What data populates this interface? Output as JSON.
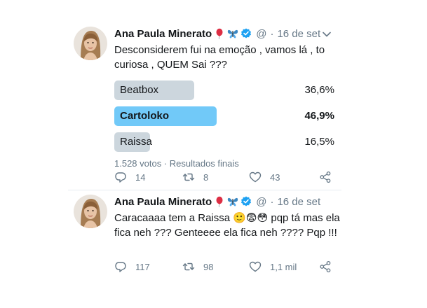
{
  "tweets": [
    {
      "author": "Ana Paula Minerato",
      "handle": "@",
      "separator": "·",
      "date": "16 de set",
      "text": "Desconsiderem fui na emoção , vamos lá , to curiosa , QUEM Sai ???",
      "header_icons": [
        "balloon-icon",
        "butterfly-icon",
        "verified-badge-icon"
      ],
      "poll": {
        "options": [
          {
            "label": "Beatbox",
            "percent_text": "36,6%",
            "value": 36.6,
            "winner": false
          },
          {
            "label": "Cartoloko",
            "percent_text": "46,9%",
            "value": 46.9,
            "winner": true
          },
          {
            "label": "Raissa",
            "percent_text": "16,5%",
            "value": 16.5,
            "winner": false
          }
        ],
        "meta": "1.528 votos · Resultados finais"
      },
      "actions": {
        "replies": "14",
        "retweets": "8",
        "likes": "43"
      }
    },
    {
      "author": "Ana Paula Minerato",
      "handle": "@",
      "separator": "·",
      "date": "16 de set",
      "text": "Caracaaaa tem a Raissa 🙂😨😳 pqp tá mas ela fica neh ??? Genteeee ela fica neh ???? Pqp !!!",
      "header_icons": [
        "balloon-icon",
        "butterfly-icon",
        "verified-badge-icon"
      ],
      "actions": {
        "replies": "117",
        "retweets": "98",
        "likes": "1,1 mil"
      }
    }
  ],
  "colors": {
    "poll_winner": "#71c9f8",
    "poll_default": "#ccd6dd",
    "secondary_text": "#657786",
    "verified": "#1da1f2"
  }
}
